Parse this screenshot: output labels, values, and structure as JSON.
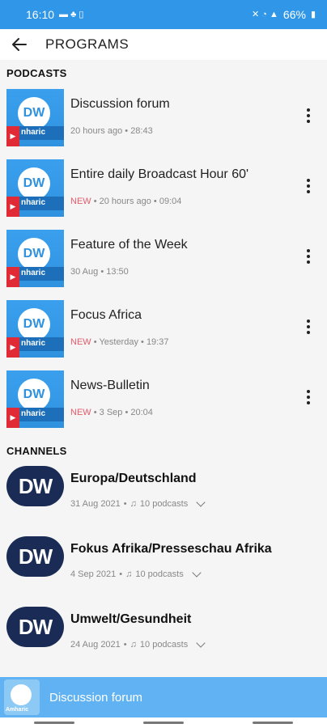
{
  "status_bar": {
    "time": "16:10",
    "battery": "66%"
  },
  "header": {
    "title": "PROGRAMS"
  },
  "podcasts_section": {
    "title": "PODCASTS"
  },
  "podcasts": [
    {
      "title": "Discussion forum",
      "new": "",
      "date": "20 hours ago",
      "duration": "28:43"
    },
    {
      "title": "Entire daily Broadcast Hour 60'",
      "new": "NEW",
      "date": "20 hours ago",
      "duration": "09:04"
    },
    {
      "title": "Feature of the Week",
      "new": "",
      "date": "30 Aug",
      "duration": "13:50"
    },
    {
      "title": "Focus Africa",
      "new": "NEW",
      "date": "Yesterday",
      "duration": "19:37"
    },
    {
      "title": "News-Bulletin",
      "new": "NEW",
      "date": "3 Sep",
      "duration": "20:04"
    }
  ],
  "thumb": {
    "logo": "DW",
    "lang": "nharic"
  },
  "channels_section": {
    "title": "CHANNELS"
  },
  "channels": [
    {
      "title": "Europa/Deutschland",
      "date": "31 Aug 2021",
      "podcasts": "10 podcasts"
    },
    {
      "title": "Fokus Afrika/Presseschau Afrika",
      "date": "4 Sep 2021",
      "podcasts": "10 podcasts"
    },
    {
      "title": "Umwelt/Gesundheit",
      "date": "24 Aug 2021",
      "podcasts": "10 podcasts"
    }
  ],
  "channel_logo": "DW",
  "player": {
    "title": "Discussion forum",
    "thumb_label": "Amharic"
  },
  "colors": {
    "accent": "#2f96e8",
    "new": "#e25b6a",
    "dw_navy": "#1a2c55"
  }
}
